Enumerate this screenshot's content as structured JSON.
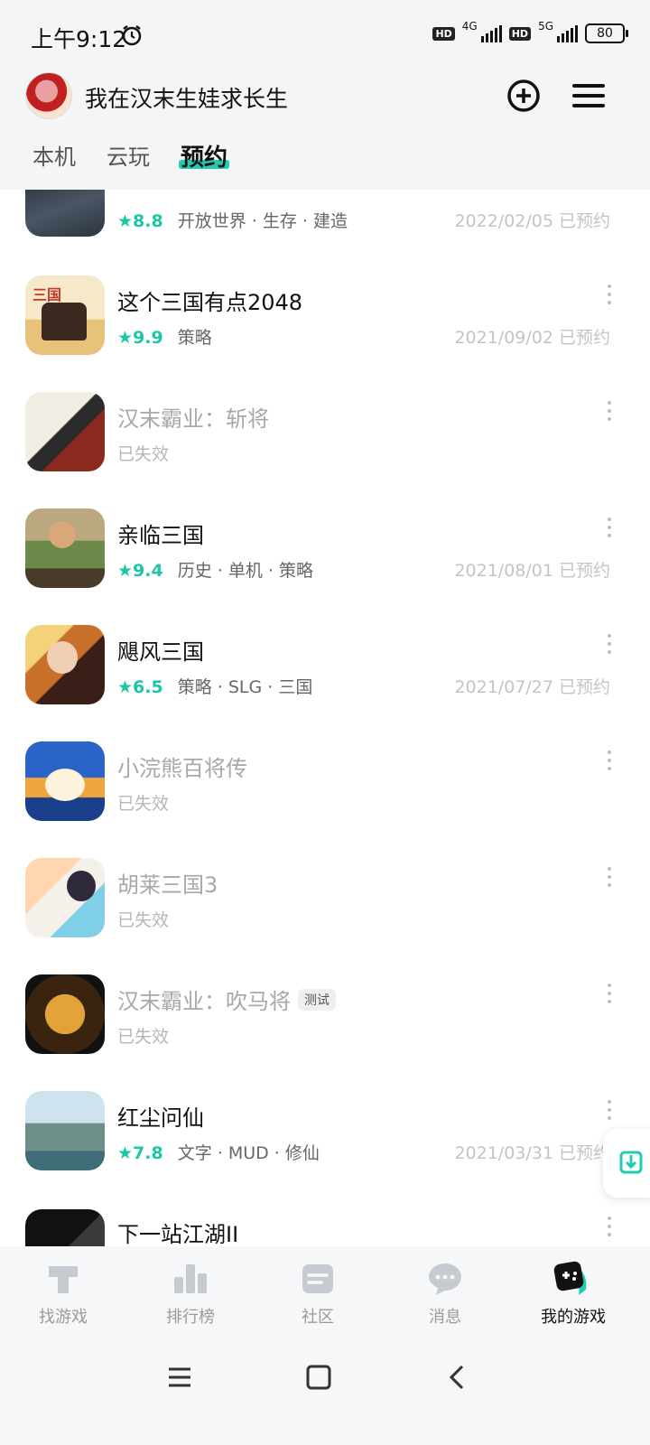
{
  "status_bar": {
    "time": "上午9:12",
    "net1": "4G",
    "net2": "5G",
    "hd": "HD",
    "battery": "80"
  },
  "header": {
    "title": "我在汉末生娃求长生"
  },
  "tabs": [
    {
      "label": "本机"
    },
    {
      "label": "云玩"
    },
    {
      "label": "预约",
      "active": true
    }
  ],
  "games": [
    {
      "name": "",
      "rating": "8.8",
      "tags": "开放世界 · 生存 · 建造",
      "date": "2022/02/05 已预约",
      "valid": true
    },
    {
      "name": "这个三国有点2048",
      "rating": "9.9",
      "tags": "策略",
      "date": "2021/09/02 已预约",
      "valid": true
    },
    {
      "name": "汉末霸业：斩将",
      "status": "已失效",
      "valid": false
    },
    {
      "name": "亲临三国",
      "rating": "9.4",
      "tags": "历史 · 单机 · 策略",
      "date": "2021/08/01 已预约",
      "valid": true
    },
    {
      "name": "飓风三国",
      "rating": "6.5",
      "tags": "策略 · SLG · 三国",
      "date": "2021/07/27 已预约",
      "valid": true
    },
    {
      "name": "小浣熊百将传",
      "status": "已失效",
      "valid": false
    },
    {
      "name": "胡莱三国3",
      "status": "已失效",
      "valid": false
    },
    {
      "name": "汉末霸业：吹马将",
      "badge": "测试",
      "status": "已失效",
      "valid": false
    },
    {
      "name": "红尘问仙",
      "rating": "7.8",
      "tags": "文字 · MUD · 修仙",
      "date": "2021/03/31 已预约",
      "valid": true
    },
    {
      "name": "下一站江湖II",
      "valid": true
    }
  ],
  "bottom_nav": [
    {
      "label": "找游戏",
      "icon": "find-games-icon"
    },
    {
      "label": "排行榜",
      "icon": "ranking-icon"
    },
    {
      "label": "社区",
      "icon": "community-icon"
    },
    {
      "label": "消息",
      "icon": "message-icon"
    },
    {
      "label": "我的游戏",
      "icon": "my-games-icon",
      "active": true
    }
  ],
  "colors": {
    "accent": "#1cc6a7",
    "tab_underline": "#22ccb0"
  }
}
